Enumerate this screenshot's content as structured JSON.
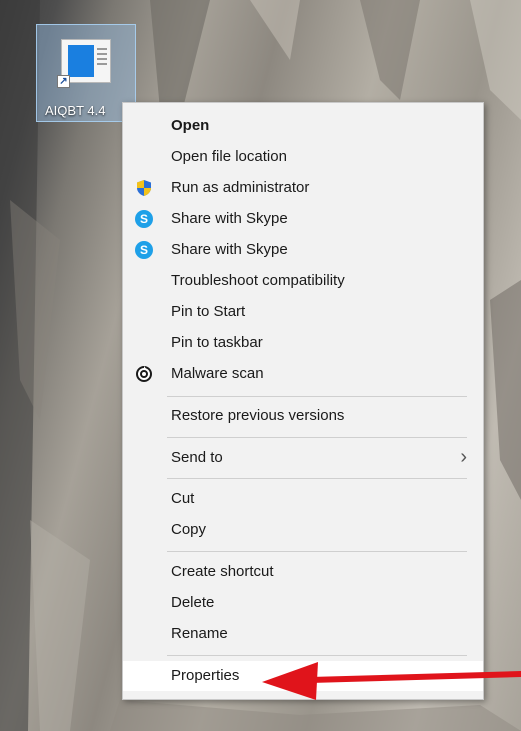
{
  "desktop": {
    "shortcut": {
      "label": "AIQBT 4.4"
    }
  },
  "context_menu": {
    "items": [
      {
        "label": "Open",
        "bold": true
      },
      {
        "label": "Open file location"
      },
      {
        "label": "Run as administrator",
        "icon": "uac-shield-icon"
      },
      {
        "label": "Share with Skype",
        "icon": "skype-icon"
      },
      {
        "label": "Share with Skype",
        "icon": "skype-icon"
      },
      {
        "label": "Troubleshoot compatibility"
      },
      {
        "label": "Pin to Start"
      },
      {
        "label": "Pin to taskbar"
      },
      {
        "label": "Malware scan",
        "icon": "malware-scan-icon"
      },
      {
        "label": "Restore previous versions"
      },
      {
        "label": "Send to",
        "submenu": true
      },
      {
        "label": "Cut"
      },
      {
        "label": "Copy"
      },
      {
        "label": "Create shortcut"
      },
      {
        "label": "Delete"
      },
      {
        "label": "Rename"
      },
      {
        "label": "Properties",
        "highlighted": true
      }
    ],
    "chevron_glyph": "›"
  },
  "colors": {
    "menu_background": "#f2f2f2",
    "selection_highlight": "#cce4f7",
    "annotation_arrow": "#e0141b",
    "skype_blue": "#1ea0e8",
    "uac_blue": "#2b6fd6",
    "uac_yellow": "#f3c21b"
  }
}
